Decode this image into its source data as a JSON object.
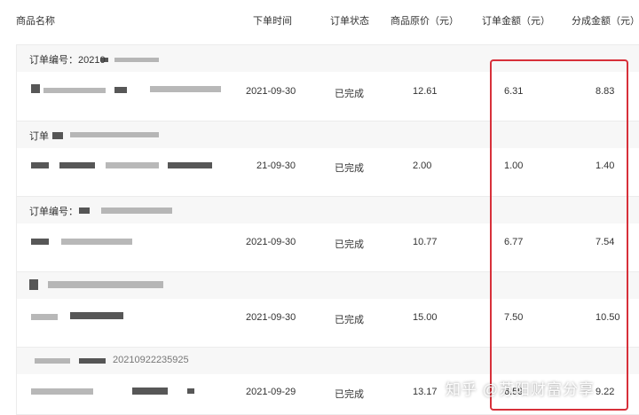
{
  "header": {
    "name": "商品名称",
    "time": "下单时间",
    "status": "订单状态",
    "price": "商品原价（元）",
    "amount": "订单金额（元）",
    "commission": "分成金额（元）"
  },
  "orders": [
    {
      "label": "订单编号：",
      "number": "20210",
      "time": "2021-09-30",
      "status": "已完成",
      "price": "12.61",
      "amount": "6.31",
      "commission": "8.83"
    },
    {
      "label": "订单",
      "number": "",
      "time": "21-09-30",
      "status": "已完成",
      "price": "2.00",
      "amount": "1.00",
      "commission": "1.40"
    },
    {
      "label": "订单编号：",
      "number": "",
      "time": "2021-09-30",
      "status": "已完成",
      "price": "10.77",
      "amount": "6.77",
      "commission": "7.54"
    },
    {
      "label": "",
      "number": "",
      "time": "2021-09-30",
      "status": "已完成",
      "price": "15.00",
      "amount": "7.50",
      "commission": "10.50"
    },
    {
      "label": "",
      "number": "20210922235925",
      "time": "2021-09-29",
      "status": "已完成",
      "price": "13.17",
      "amount": "6.59",
      "commission": "9.22"
    }
  ],
  "watermark": "知乎 @苏阳财富分享"
}
